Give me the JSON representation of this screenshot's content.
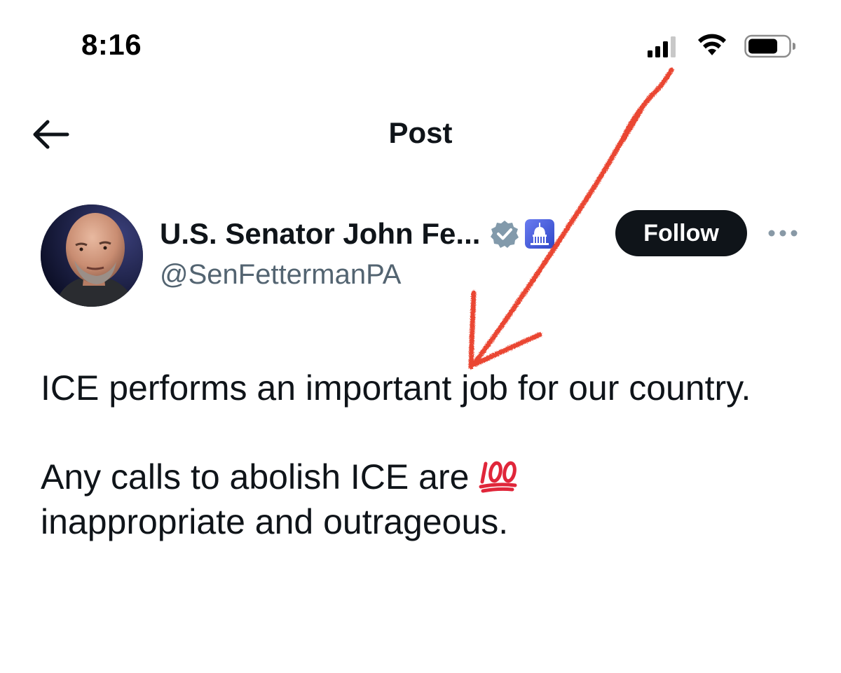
{
  "status_bar": {
    "time": "8:16",
    "signal_icon": "cellular-signal-icon",
    "wifi_icon": "wifi-icon",
    "battery_icon": "battery-icon"
  },
  "nav": {
    "back_icon": "back-arrow-icon",
    "title": "Post"
  },
  "post": {
    "author": {
      "display_name": "U.S. Senator John Fe...",
      "handle": "@SenFettermanPA",
      "verified_icon": "verified-badge-icon",
      "affiliation_icon": "capitol-dome-icon"
    },
    "follow_label": "Follow",
    "more_icon": "more-options-icon",
    "paragraphs": [
      "ICE performs an important job for our country.",
      "Any calls to abolish ICE are",
      "inappropriate and outrageous."
    ],
    "emoji": "100-emoji"
  },
  "annotation": {
    "type": "hand-drawn-arrow",
    "color": "#e8321e"
  },
  "colors": {
    "text_primary": "#0f1419",
    "text_secondary": "#536471",
    "follow_bg": "#0f1419",
    "verified": "#829aab"
  }
}
